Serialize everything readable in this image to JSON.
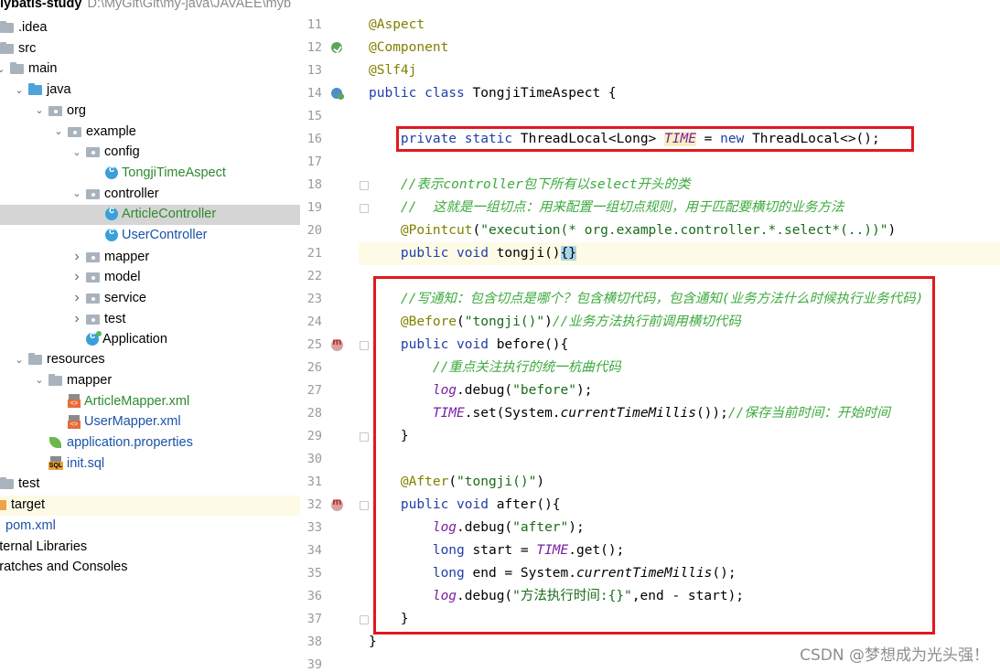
{
  "project": {
    "title": "lybatis-study",
    "path": "D:\\MyGit\\Git\\my-java\\JAVAEE\\myb"
  },
  "tree": [
    {
      "label": ".idea",
      "icon": "folder-icon",
      "depth": 0,
      "arrow": "none",
      "style": "normal"
    },
    {
      "label": "src",
      "icon": "folder-icon",
      "depth": 0,
      "arrow": "none",
      "style": "normal"
    },
    {
      "label": "main",
      "icon": "folder-icon",
      "depth": 0,
      "arrow": "expanded",
      "style": "normal"
    },
    {
      "label": "java",
      "icon": "source-folder-icon",
      "depth": 1,
      "arrow": "expanded",
      "style": "normal"
    },
    {
      "label": "org",
      "icon": "package-icon",
      "depth": 2,
      "arrow": "expanded",
      "style": "normal"
    },
    {
      "label": "example",
      "icon": "package-icon",
      "depth": 3,
      "arrow": "expanded",
      "style": "normal"
    },
    {
      "label": "config",
      "icon": "package-icon",
      "depth": 4,
      "arrow": "expanded",
      "style": "normal"
    },
    {
      "label": "TongjiTimeAspect",
      "icon": "class-icon",
      "depth": 5,
      "arrow": "none",
      "style": "green"
    },
    {
      "label": "controller",
      "icon": "package-icon",
      "depth": 4,
      "arrow": "expanded",
      "style": "normal"
    },
    {
      "label": "ArticleController",
      "icon": "class-icon",
      "depth": 5,
      "arrow": "none",
      "style": "green",
      "selected": true
    },
    {
      "label": "UserController",
      "icon": "class-icon",
      "depth": 5,
      "arrow": "none",
      "style": "blue"
    },
    {
      "label": "mapper",
      "icon": "package-icon",
      "depth": 4,
      "arrow": "collapsed",
      "style": "normal"
    },
    {
      "label": "model",
      "icon": "package-icon",
      "depth": 4,
      "arrow": "collapsed",
      "style": "normal"
    },
    {
      "label": "service",
      "icon": "package-icon",
      "depth": 4,
      "arrow": "collapsed",
      "style": "normal"
    },
    {
      "label": "test",
      "icon": "package-icon",
      "depth": 4,
      "arrow": "collapsed",
      "style": "normal"
    },
    {
      "label": "Application",
      "icon": "spring-app-icon",
      "depth": 4,
      "arrow": "none",
      "style": "normal"
    },
    {
      "label": "resources",
      "icon": "resources-folder-icon",
      "depth": 1,
      "arrow": "expanded",
      "style": "normal"
    },
    {
      "label": "mapper",
      "icon": "folder-icon",
      "depth": 2,
      "arrow": "expanded",
      "style": "normal"
    },
    {
      "label": "ArticleMapper.xml",
      "icon": "xml-file-icon",
      "depth": 3,
      "arrow": "none",
      "style": "green"
    },
    {
      "label": "UserMapper.xml",
      "icon": "xml-file-icon",
      "depth": 3,
      "arrow": "none",
      "style": "blue"
    },
    {
      "label": "application.properties",
      "icon": "spring-leaf-icon",
      "depth": 2,
      "arrow": "none",
      "style": "blue"
    },
    {
      "label": "init.sql",
      "icon": "sql-file-icon",
      "depth": 2,
      "arrow": "none",
      "style": "blue"
    },
    {
      "label": "test",
      "icon": "folder-icon",
      "depth": 0,
      "arrow": "none",
      "style": "normal"
    },
    {
      "label": "target",
      "icon": "excluded-folder-icon",
      "depth": -1,
      "arrow": "none",
      "style": "normal",
      "highlight": true
    },
    {
      "label": "pom.xml",
      "icon": "maven-icon",
      "depth": -1,
      "arrow": "none",
      "style": "blue"
    },
    {
      "label": "xternal Libraries",
      "icon": "none",
      "depth": -1,
      "arrow": "none",
      "style": "normal"
    },
    {
      "label": "cratches and Consoles",
      "icon": "none",
      "depth": -1,
      "arrow": "none",
      "style": "normal"
    }
  ],
  "editor": {
    "lines": [
      {
        "n": "11",
        "mark": "",
        "fold": false,
        "segs": [
          [
            "ann",
            "@Aspect"
          ]
        ]
      },
      {
        "n": "12",
        "mark": "bean",
        "fold": false,
        "segs": [
          [
            "ann",
            "@Component"
          ]
        ]
      },
      {
        "n": "13",
        "mark": "",
        "fold": false,
        "segs": [
          [
            "ann",
            "@Slf4j"
          ]
        ]
      },
      {
        "n": "14",
        "mark": "pc",
        "fold": false,
        "segs": [
          [
            "kw",
            "public class "
          ],
          [
            "",
            "TongjiTimeAspect {"
          ]
        ]
      },
      {
        "n": "15",
        "mark": "",
        "fold": false,
        "segs": []
      },
      {
        "n": "16",
        "mark": "",
        "fold": false,
        "segs": [
          [
            "",
            "    "
          ],
          [
            "kw",
            "private static "
          ],
          [
            "",
            "ThreadLocal<Long> "
          ],
          [
            "tm",
            "TIME"
          ],
          [
            "",
            " = "
          ],
          [
            "kw",
            "new "
          ],
          [
            "",
            "ThreadLocal<>();"
          ]
        ]
      },
      {
        "n": "17",
        "mark": "",
        "fold": false,
        "segs": []
      },
      {
        "n": "18",
        "mark": "",
        "fold": true,
        "segs": [
          [
            "",
            "    "
          ],
          [
            "cm",
            "//表示controller包下所有以select开头的类"
          ]
        ]
      },
      {
        "n": "19",
        "mark": "",
        "fold": true,
        "segs": [
          [
            "",
            "    "
          ],
          [
            "cm",
            "//  这就是一组切点：用来配置一组切点规则，用于匹配要横切的业务方法"
          ]
        ]
      },
      {
        "n": "20",
        "mark": "",
        "fold": false,
        "segs": [
          [
            "",
            "    "
          ],
          [
            "ann",
            "@Pointcut"
          ],
          [
            "",
            "("
          ],
          [
            "str",
            "\"execution(* org.example.controller.*.select*(..))\""
          ],
          [
            "",
            ")"
          ]
        ]
      },
      {
        "n": "21",
        "mark": "",
        "fold": false,
        "current": true,
        "segs": [
          [
            "",
            "    "
          ],
          [
            "kw",
            "public void "
          ],
          [
            "",
            "tongji()"
          ],
          [
            "brace",
            "{}"
          ]
        ]
      },
      {
        "n": "22",
        "mark": "",
        "fold": false,
        "segs": []
      },
      {
        "n": "23",
        "mark": "",
        "fold": false,
        "segs": [
          [
            "",
            "    "
          ],
          [
            "cm",
            "//写通知：包含切点是哪个？包含横切代码，包含通知(业务方法什么时候执行业务代码)"
          ]
        ]
      },
      {
        "n": "24",
        "mark": "",
        "fold": false,
        "segs": [
          [
            "",
            "    "
          ],
          [
            "ann",
            "@Before"
          ],
          [
            "",
            "("
          ],
          [
            "str",
            "\"tongji()\""
          ],
          [
            "",
            ")"
          ],
          [
            "cm",
            "//业务方法执行前调用横切代码"
          ]
        ]
      },
      {
        "n": "25",
        "mark": "adv",
        "fold": true,
        "segs": [
          [
            "",
            "    "
          ],
          [
            "kw",
            "public void "
          ],
          [
            "",
            "before(){"
          ]
        ]
      },
      {
        "n": "26",
        "mark": "",
        "fold": false,
        "segs": [
          [
            "",
            "        "
          ],
          [
            "cm",
            "//重点关注执行的统一杭曲代码"
          ]
        ]
      },
      {
        "n": "27",
        "mark": "",
        "fold": false,
        "segs": [
          [
            "",
            "        "
          ],
          [
            "fld",
            "log"
          ],
          [
            "",
            ".debug("
          ],
          [
            "str",
            "\"before\""
          ],
          [
            "",
            ");"
          ]
        ]
      },
      {
        "n": "28",
        "mark": "",
        "fold": false,
        "segs": [
          [
            "",
            "        "
          ],
          [
            "fld",
            "TIME"
          ],
          [
            "",
            ".set(System."
          ],
          [
            "it",
            "currentTimeMillis"
          ],
          [
            "",
            "());"
          ],
          [
            "cm",
            "//保存当前时间：开始时间"
          ]
        ]
      },
      {
        "n": "29",
        "mark": "",
        "fold": true,
        "segs": [
          [
            "",
            "    }"
          ]
        ]
      },
      {
        "n": "30",
        "mark": "",
        "fold": false,
        "segs": []
      },
      {
        "n": "31",
        "mark": "",
        "fold": false,
        "segs": [
          [
            "",
            "    "
          ],
          [
            "ann",
            "@After"
          ],
          [
            "",
            "("
          ],
          [
            "str",
            "\"tongji()\""
          ],
          [
            "",
            ")"
          ]
        ]
      },
      {
        "n": "32",
        "mark": "adv",
        "fold": true,
        "segs": [
          [
            "",
            "    "
          ],
          [
            "kw",
            "public void "
          ],
          [
            "",
            "after(){"
          ]
        ]
      },
      {
        "n": "33",
        "mark": "",
        "fold": false,
        "segs": [
          [
            "",
            "        "
          ],
          [
            "fld",
            "log"
          ],
          [
            "",
            ".debug("
          ],
          [
            "str",
            "\"after\""
          ],
          [
            "",
            ");"
          ]
        ]
      },
      {
        "n": "34",
        "mark": "",
        "fold": false,
        "segs": [
          [
            "",
            "        "
          ],
          [
            "kw",
            "long "
          ],
          [
            "",
            "start = "
          ],
          [
            "fld",
            "TIME"
          ],
          [
            "",
            ".get();"
          ]
        ]
      },
      {
        "n": "35",
        "mark": "",
        "fold": false,
        "segs": [
          [
            "",
            "        "
          ],
          [
            "kw",
            "long "
          ],
          [
            "",
            "end = System."
          ],
          [
            "it",
            "currentTimeMillis"
          ],
          [
            "",
            "();"
          ]
        ]
      },
      {
        "n": "36",
        "mark": "",
        "fold": false,
        "segs": [
          [
            "",
            "        "
          ],
          [
            "fld",
            "log"
          ],
          [
            "",
            ".debug("
          ],
          [
            "str",
            "\"方法执行时间:{}\""
          ],
          [
            "",
            ",end - start);"
          ]
        ]
      },
      {
        "n": "37",
        "mark": "",
        "fold": true,
        "segs": [
          [
            "",
            "    }"
          ]
        ]
      },
      {
        "n": "38",
        "mark": "",
        "fold": false,
        "segs": [
          [
            "",
            "}"
          ]
        ]
      },
      {
        "n": "39",
        "mark": "",
        "fold": false,
        "segs": []
      }
    ]
  },
  "watermark": "CSDN @梦想成为光头强！"
}
